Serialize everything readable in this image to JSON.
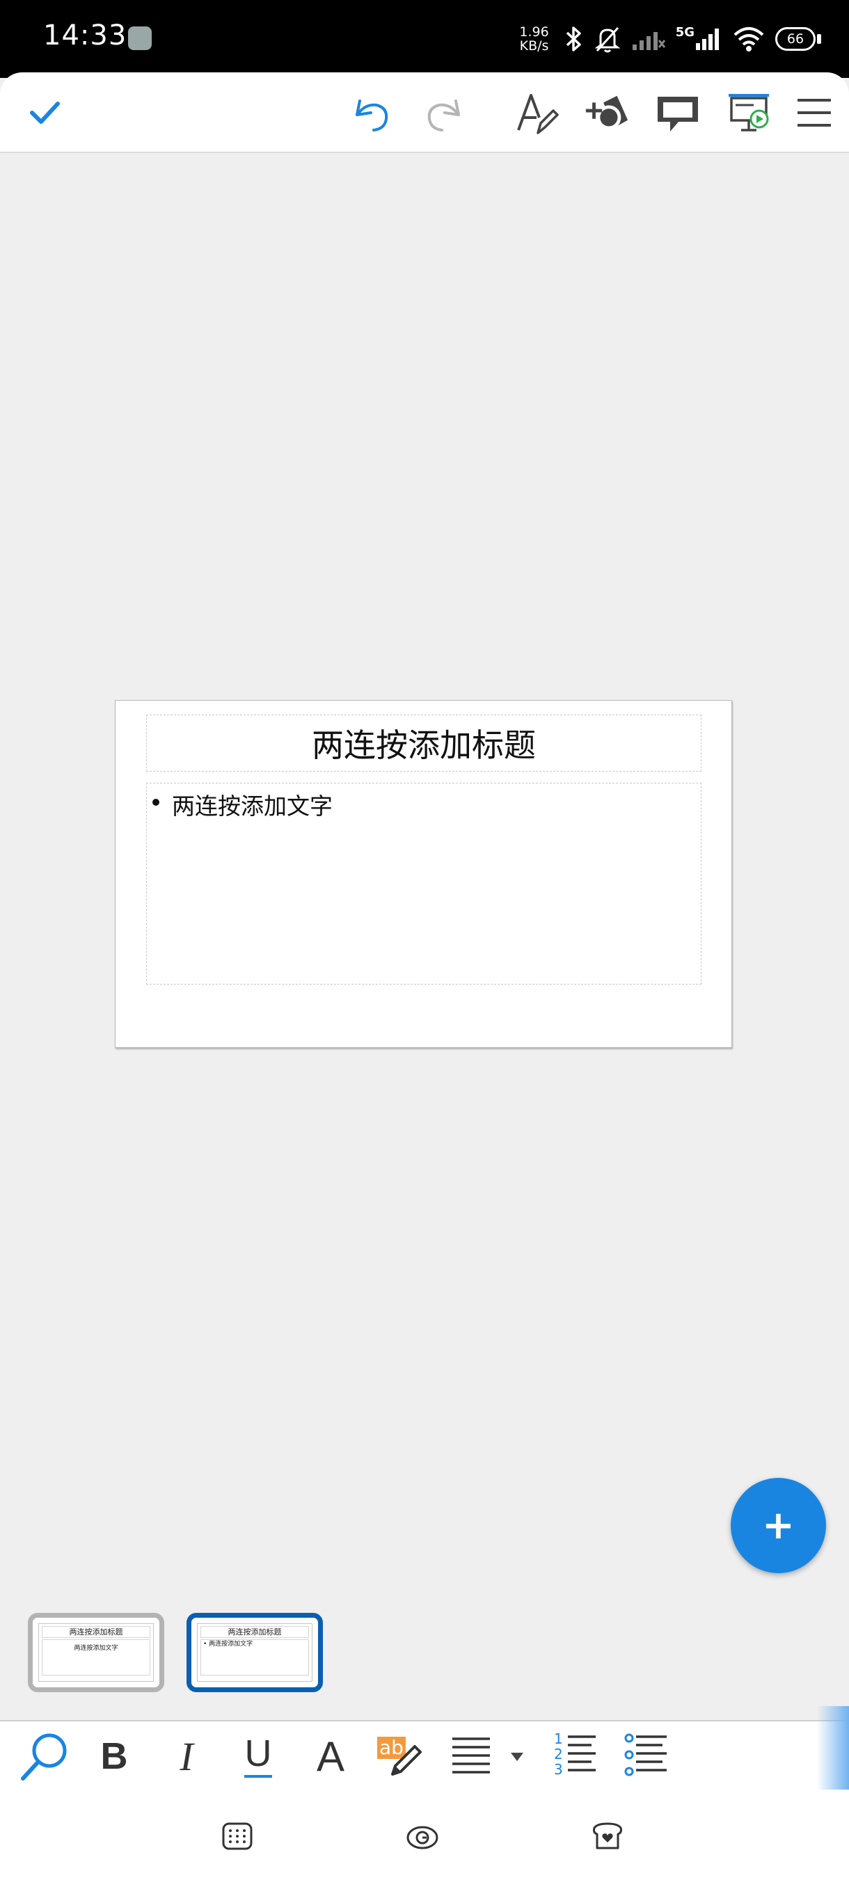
{
  "status_bar": {
    "time": "14:33",
    "net_speed_value": "1.96",
    "net_speed_unit": "KB/s",
    "network_type": "5G",
    "battery": "66"
  },
  "toolbar": {
    "done_icon": "checkmark-icon",
    "undo_icon": "undo-icon",
    "redo_icon": "redo-icon",
    "format_icon": "text-format-icon",
    "insert_icon": "insert-icon",
    "comment_icon": "comment-icon",
    "slideshow_icon": "slideshow-icon",
    "menu_icon": "hamburger-menu-icon",
    "accent_color": "#1a85e0"
  },
  "slide": {
    "title_placeholder": "两连按添加标题",
    "body_placeholder": "两连按添加文字"
  },
  "fab": {
    "label": "+"
  },
  "thumbnails": [
    {
      "title": "两连按添加标题",
      "body": "两连按添加文字",
      "selected": false
    },
    {
      "title": "两连按添加标题",
      "body": "• 两连按添加文字",
      "selected": true
    }
  ],
  "format_bar": {
    "bold": "B",
    "italic": "I",
    "underline": "U",
    "font_color": "A",
    "highlight": "ab",
    "numbered_list_digits": [
      "1",
      "2",
      "3"
    ]
  },
  "nav_bar": {
    "left_icon": "keyboard-grid-icon",
    "center_icon": "swirl-icon",
    "right_icon": "bread-heart-icon"
  }
}
